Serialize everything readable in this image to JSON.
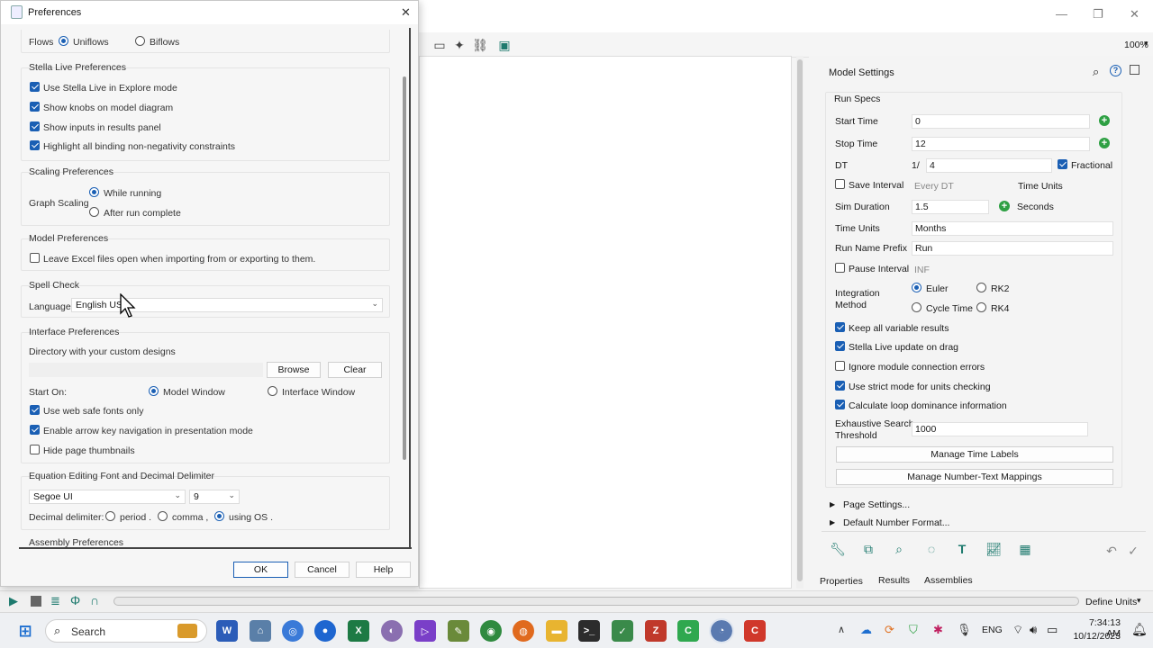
{
  "main": {
    "zoom": "100%",
    "win_min": "—",
    "win_max": "❐",
    "win_close": "✕"
  },
  "settings": {
    "title": "Model Settings",
    "run_specs": "Run Specs",
    "start_time_label": "Start Time",
    "start_time": "0",
    "stop_time_label": "Stop Time",
    "stop_time": "12",
    "dt_label": "DT",
    "dt_prefix": "1/",
    "dt_value": "4",
    "fractional": "Fractional",
    "save_interval": "Save Interval",
    "every_dt": "Every DT",
    "time_units_hdr": "Time Units",
    "sim_duration_label": "Sim Duration",
    "sim_duration": "1.5",
    "seconds": "Seconds",
    "time_units_label": "Time Units",
    "time_units": "Months",
    "run_name_prefix_label": "Run Name Prefix",
    "run_name_prefix": "Run",
    "pause_interval": "Pause Interval",
    "pause_value": "INF",
    "integration_method": "Integration\nMethod",
    "euler": "Euler",
    "rk2": "RK2",
    "cycle_time": "Cycle Time",
    "rk4": "RK4",
    "keep_all": "Keep all variable results",
    "stella_live_drag": "Stella Live update on drag",
    "ignore_module": "Ignore module connection errors",
    "strict_units": "Use strict mode for units checking",
    "loop_dominance": "Calculate loop dominance information",
    "exhaustive_label": "Exhaustive Search\nThreshold",
    "exhaustive_value": "1000",
    "manage_time_labels": "Manage Time Labels",
    "manage_number_text": "Manage Number-Text Mappings",
    "page_settings": "Page Settings...",
    "default_number_format": "Default Number Format...",
    "tabs": [
      "Properties",
      "Results",
      "Assemblies"
    ],
    "define_units": "Define Units"
  },
  "prefs": {
    "title": "Preferences",
    "close": "✕",
    "flows_label": "Flows",
    "uniflows": "Uniflows",
    "biflows": "Biflows",
    "stella_live": "Stella Live Preferences",
    "use_stella_live": "Use Stella Live in Explore mode",
    "show_knobs": "Show knobs on model diagram",
    "show_inputs": "Show inputs in results panel",
    "highlight_binding": "Highlight all binding non-negativity constraints",
    "scaling": "Scaling Preferences",
    "graph_scaling": "Graph Scaling",
    "while_running": "While running",
    "after_run": "After run complete",
    "model_prefs": "Model Preferences",
    "leave_excel": "Leave Excel files open when importing from or exporting to them.",
    "spell_check": "Spell Check",
    "language_label": "Language",
    "language": "English US",
    "interface_prefs": "Interface Preferences",
    "directory": "Directory with your custom designs",
    "browse": "Browse",
    "clear": "Clear",
    "start_on": "Start On:",
    "model_window": "Model Window",
    "interface_window": "Interface Window",
    "web_safe": "Use web safe fonts only",
    "arrow_nav": "Enable arrow key navigation in presentation mode",
    "hide_thumbs": "Hide page thumbnails",
    "equation_font": "Equation Editing Font and Decimal Delimiter",
    "font": "Segoe UI",
    "font_size": "9",
    "decimal_label": "Decimal delimiter:",
    "period": "period .",
    "comma": "comma ,",
    "using_os": "using OS .",
    "assembly": "Assembly Preferences",
    "ok": "OK",
    "cancel": "Cancel",
    "help": "Help"
  },
  "taskbar": {
    "search": "Search",
    "lang": "ENG",
    "time": "7:34:13 AM",
    "date": "10/12/2023"
  }
}
